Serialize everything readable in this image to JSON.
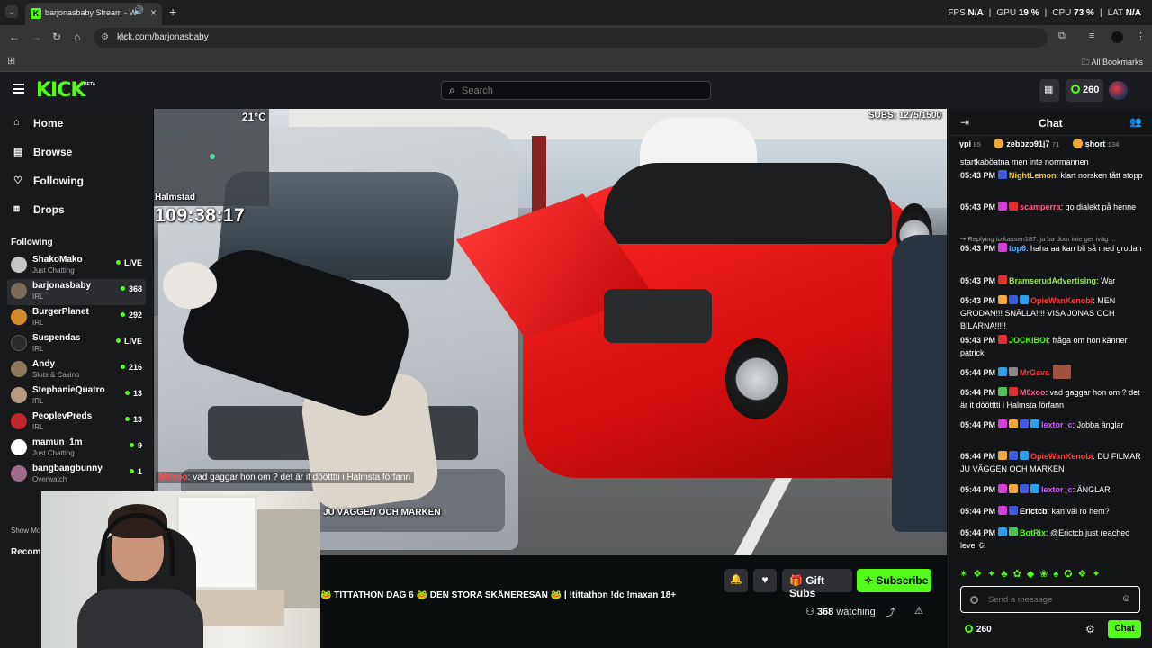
{
  "browser": {
    "tab_title": "barjonasbaby Stream - Watch",
    "url": "kick.com/barjonasbaby",
    "bookmarks_label": "All Bookmarks",
    "perf": {
      "fps_label": "FPS",
      "fps_value": "N/A",
      "gpu_label": "GPU",
      "gpu_value": "19 %",
      "cpu_label": "CPU",
      "cpu_value": "73 %",
      "lat_label": "LAT",
      "lat_value": "N/A"
    }
  },
  "header": {
    "logo": "KICK",
    "beta": "BETA",
    "search_placeholder": "Search",
    "kicks": "260"
  },
  "sidebar": {
    "nav": [
      {
        "label": "Home",
        "icon": "home-icon"
      },
      {
        "label": "Browse",
        "icon": "browse-icon"
      },
      {
        "label": "Following",
        "icon": "heart-icon"
      },
      {
        "label": "Drops",
        "icon": "drops-icon"
      }
    ],
    "following_title": "Following",
    "channels": [
      {
        "name": "ShakoMako",
        "category": "Just Chatting",
        "viewers": "LIVE",
        "color": "#c8c8c8"
      },
      {
        "name": "barjonasbaby",
        "category": "IRL",
        "viewers": "368",
        "color": "#7a6a5a"
      },
      {
        "name": "BurgerPlanet",
        "category": "IRL",
        "viewers": "292",
        "color": "#d48a2a"
      },
      {
        "name": "Suspendas",
        "category": "IRL",
        "viewers": "LIVE",
        "color": "#2a2a2a"
      },
      {
        "name": "Andy",
        "category": "Slots & Casino",
        "viewers": "216",
        "color": "#8a7a5a"
      },
      {
        "name": "StephanieQuatro",
        "category": "IRL",
        "viewers": "13",
        "color": "#b89a80"
      },
      {
        "name": "PeoplevPreds",
        "category": "IRL",
        "viewers": "13",
        "color": "#c0272d"
      },
      {
        "name": "mamun_1m",
        "category": "Just Chatting",
        "viewers": "9",
        "color": "#ffffff"
      },
      {
        "name": "bangbangbunny",
        "category": "Overwatch",
        "viewers": "1",
        "color": "#a06a8a"
      }
    ],
    "show_more": "Show More",
    "recommended_title": "Recommended"
  },
  "video": {
    "temperature": "21°C",
    "location": "Halmstad",
    "timer": "109:38:17",
    "subs": "SUBS: 1275/1500",
    "overlay_chat_user": "M0xoo",
    "overlay_chat_text": ": vad gaggar hon om ? det är it döötttti i Halmsta förfann",
    "overlay_text2": "JU VÄGGEN OCH MARKEN"
  },
  "stream": {
    "title": "🐸 TITTATHON DAG 6 🐸 DEN STORA SKÅNERESAN 🐸 | !tittathon !dc !maxan 18+",
    "gift_label": "Gift Subs",
    "subscribe_label": "Subscribe",
    "viewers": "368",
    "watching_label": "watching"
  },
  "chat": {
    "title": "Chat",
    "gifters": [
      {
        "name": "ypi",
        "count": "85"
      },
      {
        "name": "zebbzo91j7",
        "count": "71"
      },
      {
        "name": "short",
        "count": "134"
      }
    ],
    "messages": [
      {
        "time": "",
        "user": "",
        "user_color": "#ffffff",
        "text": "startkaböatna men inte norrmannen",
        "badges": []
      },
      {
        "time": "05:43 PM",
        "user": "NightLemon",
        "user_color": "#f2c744",
        "text": ": klart norsken fått stopp",
        "badges": [
          "#3b5bdb"
        ]
      },
      {
        "time": "05:43 PM",
        "user": "scamperra",
        "user_color": "#ff5c8a",
        "text": ": go dialekt på henne",
        "badges": [
          "#d63cd6",
          "#e03131"
        ]
      },
      {
        "time": "",
        "user": "",
        "user_color": "#a0a0a0",
        "text": "↪ Replying to kassen187: ja ba dom inte ger iväg ...",
        "badges": [],
        "reply": true
      },
      {
        "time": "05:43 PM",
        "user": "top6",
        "user_color": "#5ab0ff",
        "text": ": haha aa kan bli så med grodan",
        "badges": [
          "#d63cd6"
        ]
      },
      {
        "time": "05:43 PM",
        "user": "BramserudAdvertising",
        "user_color": "#9be15d",
        "text": ": War",
        "badges": [
          "#e03131"
        ]
      },
      {
        "time": "05:43 PM",
        "user": "OpieWanKenobi",
        "user_color": "#ff3b3b",
        "text": ": MEN GRODAN!!! SNÄLLA!!!! VISA JONAS OCH BILARNA!!!!!",
        "badges": [
          "#f2a93b",
          "#3b5bdb",
          "#2f9ee8"
        ]
      },
      {
        "time": "05:43 PM",
        "user": "JOCKIBOI",
        "user_color": "#53fc18",
        "text": ": fråga om hon känner patrick",
        "badges": [
          "#e03131"
        ]
      },
      {
        "time": "05:44 PM",
        "user": "MrGava",
        "user_color": "#ff3b3b",
        "text": "",
        "badges": [
          "#2f9ee8",
          "#888888"
        ]
      },
      {
        "time": "05:44 PM",
        "user": "M0xoo",
        "user_color": "#ff5c8a",
        "text": ": vad gaggar hon om ? det är it döötttti i Halmsta förfann",
        "badges": [
          "#53c05a",
          "#e03131"
        ]
      },
      {
        "time": "05:44 PM",
        "user": "lextor_c",
        "user_color": "#c85cff",
        "text": ": Jobba änglar",
        "badges": [
          "#d63cd6",
          "#f2a93b",
          "#3b5bdb",
          "#2f9ee8"
        ]
      },
      {
        "time": "05:44 PM",
        "user": "OpieWanKenobi",
        "user_color": "#ff3b3b",
        "text": ": DU FILMAR JU VÄGGEN OCH MARKEN",
        "badges": [
          "#f2a93b",
          "#3b5bdb",
          "#2f9ee8"
        ]
      },
      {
        "time": "05:44 PM",
        "user": "lextor_c",
        "user_color": "#c85cff",
        "text": ": ÄNGLAR",
        "badges": [
          "#d63cd6",
          "#f2a93b",
          "#3b5bdb",
          "#2f9ee8"
        ]
      },
      {
        "time": "05:44 PM",
        "user": "Erictcb",
        "user_color": "#ffffff",
        "text": ": kan väl ro hem?",
        "badges": [
          "#d63cd6",
          "#3b5bdb"
        ]
      },
      {
        "time": "05:44 PM",
        "user": "BotRix",
        "user_color": "#53fc18",
        "text": ": @Erictcb just reached level 6!",
        "badges": [
          "#2f9ee8",
          "#53c05a"
        ]
      }
    ],
    "input_placeholder": "Send a message",
    "kicks": "260",
    "send_label": "Chat"
  }
}
